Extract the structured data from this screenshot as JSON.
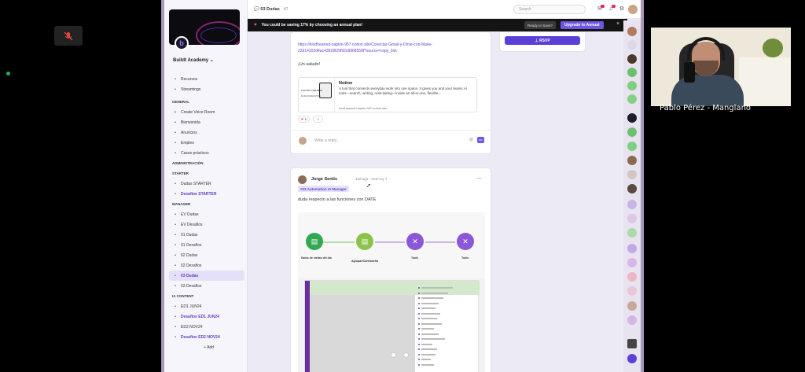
{
  "meeting": {
    "participant_name": "Pablo Pérez - Manglano"
  },
  "app": {
    "community_name": "Buildt Academy",
    "topbar": {
      "channel_title": "03 Dudas",
      "member_count": "47",
      "search_placeholder": "Search"
    },
    "promo": {
      "message": "You could be saving 17% by choosing an annual plan!",
      "ready_label": "Ready to Save?",
      "upgrade_label": "Upgrade to Annual"
    },
    "sidebar": {
      "top_items": [
        {
          "icon": "•",
          "label": "Recursos"
        },
        {
          "icon": "•",
          "label": "Streamings"
        }
      ],
      "sections": {
        "general": "GENERAL",
        "administracion": "ADMINISTRACIÓN",
        "starter": "STARTER",
        "manager": "MANAGER",
        "ia_content": "IA CONTENT"
      },
      "general_items": [
        {
          "icon": "+",
          "label": "Create Voice Room"
        },
        {
          "icon": "•",
          "label": "Bienvenida"
        },
        {
          "icon": "•",
          "label": "Anuncios"
        },
        {
          "icon": "•",
          "label": "Empleo"
        },
        {
          "icon": "•",
          "label": "Casos prácticos"
        }
      ],
      "starter_items": [
        {
          "icon": "•",
          "label": "Dudas STARTER"
        },
        {
          "icon": "•",
          "label": "Desafios STARTER"
        }
      ],
      "manager_items": [
        {
          "icon": "•",
          "label": "EV Dudas"
        },
        {
          "icon": "•",
          "label": "EV Desafios"
        },
        {
          "icon": "•",
          "label": "01 Dudas"
        },
        {
          "icon": "•",
          "label": "01 Desafios"
        },
        {
          "icon": "•",
          "label": "02 Dudas"
        },
        {
          "icon": "•",
          "label": "02 Desafios"
        },
        {
          "icon": "•",
          "label": "03 Dudas"
        },
        {
          "icon": "•",
          "label": "03 Desafios"
        }
      ],
      "ia_items": [
        {
          "icon": "•",
          "label": "ED1 JUN24"
        },
        {
          "icon": "•",
          "label": "Desafios ED1 JUN24"
        },
        {
          "icon": "•",
          "label": "ED2 NOV24"
        },
        {
          "icon": "•",
          "label": "Desafios ED2 NOV24"
        }
      ],
      "add_label": "+ Add"
    },
    "post1": {
      "link": "https://kindhearted-napkin-957.notion.site/Conectar-Gmail-y-Drive-con-Make-22d14102d4ac43928f29f92c8968558f?source=copy_link",
      "greeting": "¡Un saludo!",
      "preview": {
        "title": "Notion",
        "description": "A tool that connects everyday work into one space. It gives you and your teams AI tools—search, writing, note-taking—inside an all-in-one, flexible...",
        "url": "kindhearted-napkin-957.notion.site",
        "thumb_text": "LAYOUT CONTROL",
        "thumb_sub": "MAKE INTEGRATION"
      },
      "reaction_heart": "1",
      "reply_placeholder": "Write a reply..."
    },
    "post2": {
      "author": "Jorge Sentis",
      "meta": "12d ago · Seen by 7",
      "tag": "#03 Automation IA Manager",
      "text": "duda respecto a las funciones con DATE",
      "flow_nodes": [
        {
          "label": "Datos de visitas del día",
          "color": "#33a852"
        },
        {
          "label": "Agrupar/Contraseña",
          "color": "#8bc34a"
        },
        {
          "label": "Tools",
          "color": "#8a58d6"
        },
        {
          "label": "Tools",
          "color": "#8a58d6"
        }
      ]
    },
    "rsvp_label": "RSVP"
  },
  "colors": {
    "accent": "#5b3fd6",
    "promo_bg": "#141414",
    "sidebar_bg": "#f6f5fb"
  }
}
